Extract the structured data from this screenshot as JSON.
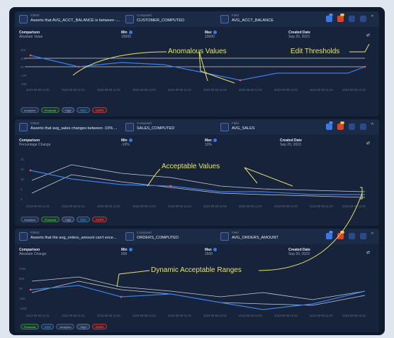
{
  "cards": [
    {
      "id": "#3942",
      "title": "Asserts that AVG_ACCT_BALANCE is between -...",
      "computed_label": "Computed",
      "computed_value": "CUSTOMER_COMPUTED",
      "field_label": "Field",
      "field_value": "AVG_ACCT_BALANCE",
      "comparison_label": "Comparison",
      "comparison_value": "Absolute Value",
      "min_label": "Min",
      "min_value": "15000",
      "max_label": "Max",
      "max_value": "10000",
      "created_label": "Created Date",
      "created_value": "Sep 20, 2023",
      "badge_blue": "21",
      "badge_orange": "30",
      "tags": [
        "Analytics",
        "Financial",
        "High",
        "SOX",
        "GDPR"
      ],
      "y_ticks": [
        "20K",
        "10K",
        "0K",
        "-10K",
        "-20K"
      ],
      "x_ticks": [
        "2023-09-08 11:00",
        "2023-09-08 11:01",
        "2023-09-08 11:02",
        "2023-09-08 11:03",
        "2023-09-08 11:03",
        "2023-09-08 11:03",
        "2023-09-08 11:03",
        "2023-09-08 11:03",
        "2023-09-08 11:03",
        "2023-09-08 11:03"
      ]
    },
    {
      "id": "#3942",
      "title": "Asserts that avg_sales changes between -10% ...",
      "computed_label": "Computed",
      "computed_value": "SALES_COMPUTED",
      "field_label": "Field",
      "field_value": "AVG_SALES",
      "comparison_label": "Comparison",
      "comparison_value": "Percentage Change",
      "min_label": "Min",
      "min_value": "-10%",
      "max_label": "Max",
      "max_value": "10%",
      "created_label": "Created Date",
      "created_value": "Sep 20, 2023",
      "badge_blue": "21",
      "badge_orange": "30",
      "tags": [
        "Analytics",
        "Financial",
        "High",
        "SOX",
        "GDPR"
      ],
      "y_ticks": [
        "20",
        "15",
        "10",
        "5",
        "0"
      ],
      "x_ticks": [
        "2023-09-08 11:01",
        "2023-09-08 11:01",
        "2023-09-08 11:02",
        "2023-09-08 11:03",
        "2023-09-08 11:03",
        "2023-09-08 11:03",
        "2023-09-08 11:03",
        "2023-09-08 11:03",
        "2023-09-08 11:03",
        "2023-09-08 11:03"
      ]
    },
    {
      "id": "#3942",
      "title": "Asserts that the avg_orders_amount can't exce...",
      "computed_label": "Computed",
      "computed_value": "ORDERS_COMPUTED",
      "field_label": "Field",
      "field_value": "AVG_ORDERS_AMOUNT",
      "comparison_label": "Comparison",
      "comparison_value": "Absolute Change",
      "min_label": "Min",
      "min_value": "500",
      "max_label": "Max",
      "max_value": "2500",
      "created_label": "Created Date",
      "created_value": "Sep 20, 2023",
      "badge_blue": "21",
      "badge_orange": "30",
      "tags": [
        "Financial",
        "SOX",
        "Analytics",
        "High",
        "GDPR"
      ],
      "y_ticks": [
        "100K",
        "50K",
        "0K",
        "-50K",
        "-100K"
      ],
      "x_ticks": [
        "2023-09-08 11:01",
        "2023-09-08 11:01",
        "2023-09-08 11:02",
        "2023-09-08 11:03",
        "2023-09-08 11:03",
        "2023-09-08 11:03",
        "2023-09-08 11:03",
        "2023-09-08 11:03",
        "2023-09-08 11:03",
        "2023-09-08 11:03"
      ]
    }
  ],
  "annotations": {
    "anomalous": "Anomalous Values",
    "edit_thresholds": "Edit Thresholds",
    "acceptable": "Acceptable Values",
    "dynamic": "Dynamic Acceptable Ranges"
  },
  "colors": {
    "series": "#3b7fe6",
    "band": "#c9cdd6",
    "annotation": "#e8e26a",
    "anomaly": "#e5573f"
  }
}
